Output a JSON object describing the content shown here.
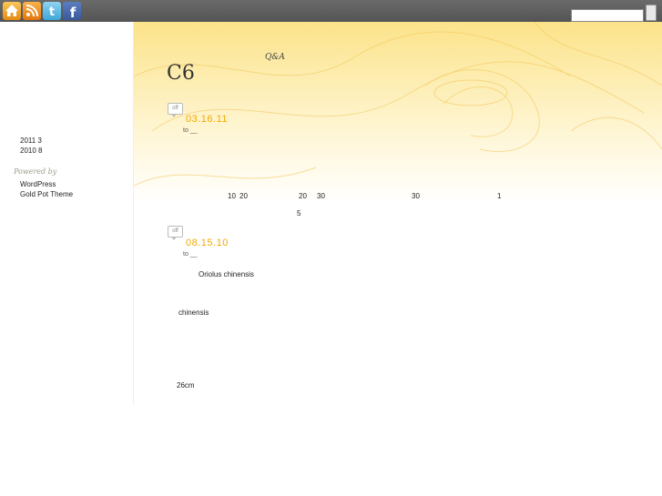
{
  "toolbar": {
    "icons": [
      "home-icon",
      "rss-icon",
      "twitter-icon",
      "facebook-icon"
    ],
    "search_value": ""
  },
  "sidebar": {
    "archives": [
      "2011 3",
      "2010 8"
    ],
    "powered_by": "Powered by",
    "links": [
      "WordPress",
      "Gold Pot Theme"
    ]
  },
  "header": {
    "title": "C6",
    "tagline": "Q&A"
  },
  "posts": [
    {
      "comments": "off",
      "date": "03.16.11",
      "to": "to __",
      "fragments": [
        "10",
        "20",
        "20",
        "30",
        "30",
        "1",
        "5"
      ]
    },
    {
      "comments": "off",
      "date": "08.15.10",
      "to": "to __",
      "fragments": [
        "Oriolus chinensis",
        "chinensis",
        "26cm"
      ]
    }
  ],
  "colors": {
    "accent": "#f2a900",
    "topbar": "#5e5e5e",
    "glow": "#fce38a"
  }
}
